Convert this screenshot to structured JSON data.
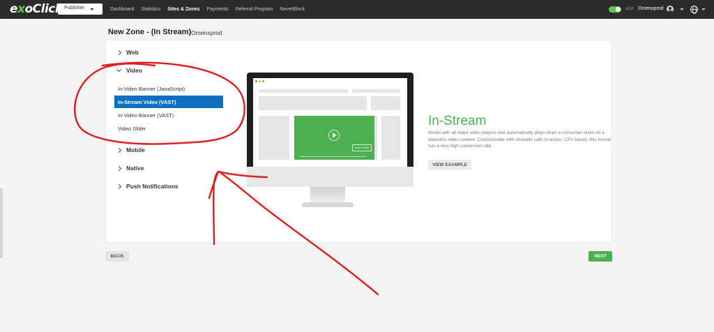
{
  "brand": {
    "logo_prefix": "e",
    "logo_o": "x",
    "logo_rest": "oClick"
  },
  "topbar": {
    "account_type": "Publisher",
    "nav": [
      "Dashboard",
      "Statistics",
      "Sites & Zones",
      "Payments",
      "Referral Program",
      "NeverBlock"
    ],
    "active_nav": "Sites & Zones",
    "version": "v2.0",
    "username": "Omenxprod"
  },
  "page": {
    "title": "New Zone - (In Stream)",
    "site": "Omenxprod"
  },
  "categories": {
    "web": "Web",
    "video": "Video",
    "mobile": "Mobile",
    "native": "Native",
    "push": "Push Notifications"
  },
  "video_formats": [
    "In-Video Banner (JavaScript)",
    "In-Stream Video (VAST)",
    "In-Video Banner (VAST)",
    "Video Slider"
  ],
  "selected_format": "In-Stream Video (VAST)",
  "preview": {
    "title": "In-Stream",
    "description": "Works with all major video players and automatically plays when a consumer clicks on a website's video content. Customizable with clickable calls to action. CPV based, this format has a very high conversion rate.",
    "view_example": "VIEW EXAMPLE",
    "skip_label": "Skip to video"
  },
  "actions": {
    "back": "BACK",
    "next": "NEXT"
  },
  "colors": {
    "accent": "#4caf50",
    "selected": "#0d6fc0",
    "annotation": "#e02020",
    "topbar": "#2b2b2b"
  }
}
